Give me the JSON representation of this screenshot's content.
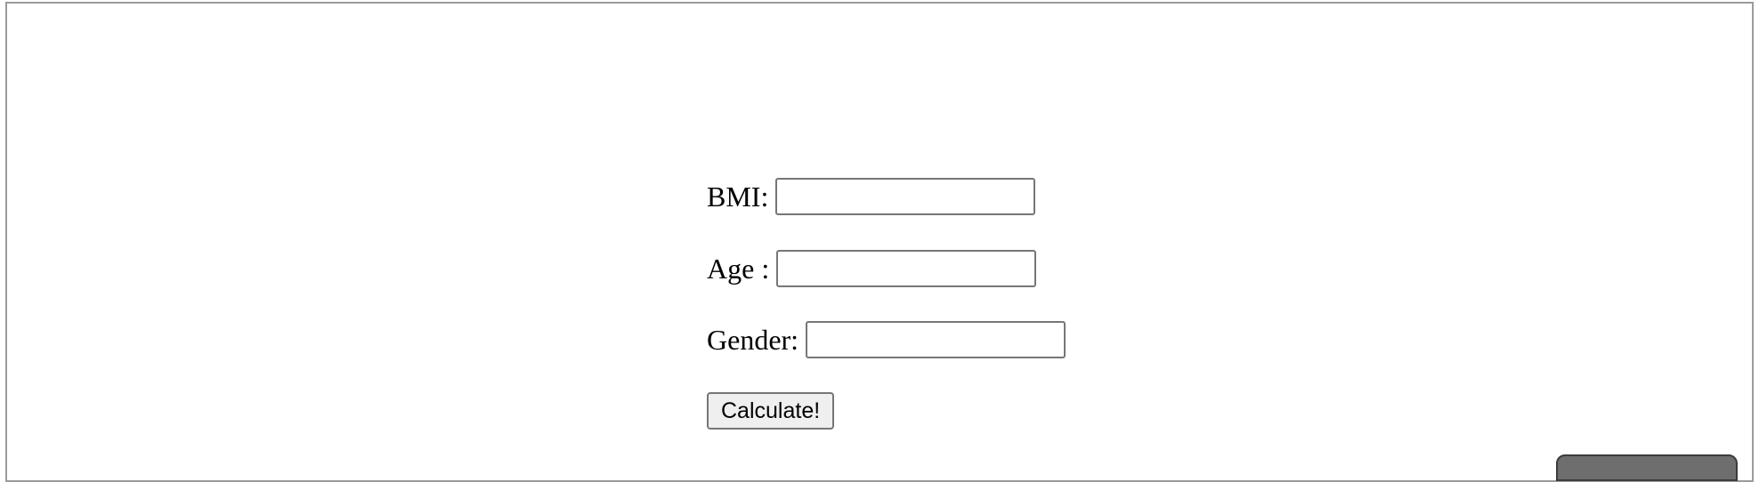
{
  "form": {
    "bmi_label": "BMI:",
    "age_label": "Age :",
    "gender_label": "Gender:",
    "bmi_value": "",
    "age_value": "",
    "gender_value": "",
    "calculate_label": "Calculate!"
  }
}
